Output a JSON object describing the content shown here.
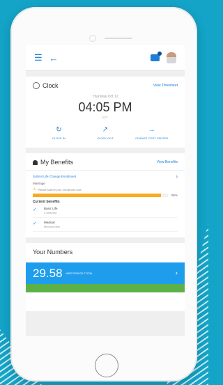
{
  "topbar": {
    "menu_icon": "☰",
    "back_icon": "←"
  },
  "clock": {
    "title": "Clock",
    "view_link": "View Timesheet",
    "date": "Thursday Oct 12",
    "time": "04:05 PM",
    "tz": "EDT",
    "actions": [
      {
        "icon": "↻",
        "label": "CLOCK IN"
      },
      {
        "icon": "↗",
        "label": "CLOCK OUT"
      },
      {
        "icon": "→",
        "label": "CHANGE COST CENTER"
      }
    ]
  },
  "benefits": {
    "title": "My Benefits",
    "view_link": "View Benefits",
    "enroll_link": "Submit Life Change Enrollment",
    "chevron": "›",
    "event": "Marriage",
    "warning_icon": "⚠",
    "warning": "Please submit your enrollment now",
    "progress_pct": 95,
    "progress_label": "95%",
    "current_label": "Current benefits",
    "items": [
      {
        "name": "Basic Life",
        "sub": "2 selected"
      },
      {
        "name": "Medical",
        "sub": "Medical New"
      }
    ],
    "check_icon": "✓"
  },
  "numbers": {
    "title": "Your Numbers",
    "value": "29.58",
    "unit": "HRS PERIOD TOTAL",
    "chevron": "›"
  },
  "colors": {
    "accent": "#1e7fd6",
    "tile_blue": "#1f9ded",
    "progress": "#f4ad22",
    "green": "#5cb146",
    "background": "#13a4c8"
  }
}
